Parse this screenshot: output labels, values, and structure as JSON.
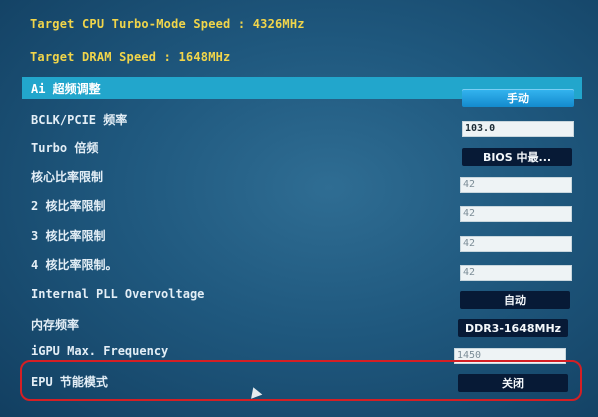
{
  "colors": {
    "background": "#1f587e",
    "info_text": "#f1d54a",
    "highlight": "#22a6cc",
    "option_button": "#071a36",
    "selection_outline": "#d51f24"
  },
  "info": {
    "cpu_speed": "Target CPU Turbo-Mode Speed : 4326MHz",
    "dram_speed": "Target DRAM Speed : 1648MHz"
  },
  "settings": [
    {
      "label": "Ai 超频调整",
      "value": "手动",
      "kind": "button"
    },
    {
      "label": "BCLK/PCIE 频率",
      "value": "103.0",
      "kind": "input"
    },
    {
      "label": "Turbo 倍频",
      "value": "BIOS 中最...",
      "kind": "button"
    },
    {
      "label": "核心比率限制",
      "value": "42",
      "kind": "input"
    },
    {
      "label": "2 核比率限制",
      "value": "42",
      "kind": "input"
    },
    {
      "label": "3 核比率限制",
      "value": "42",
      "kind": "input"
    },
    {
      "label": "4 核比率限制。",
      "value": "42",
      "kind": "input"
    },
    {
      "label": "Internal PLL Overvoltage",
      "value": "自动",
      "kind": "button"
    },
    {
      "label": "内存频率",
      "value": "DDR3-1648MHz",
      "kind": "button"
    },
    {
      "label": "iGPU Max. Frequency",
      "value": "1450",
      "kind": "input"
    },
    {
      "label": "EPU 节能模式",
      "value": "关闭",
      "kind": "button"
    }
  ]
}
